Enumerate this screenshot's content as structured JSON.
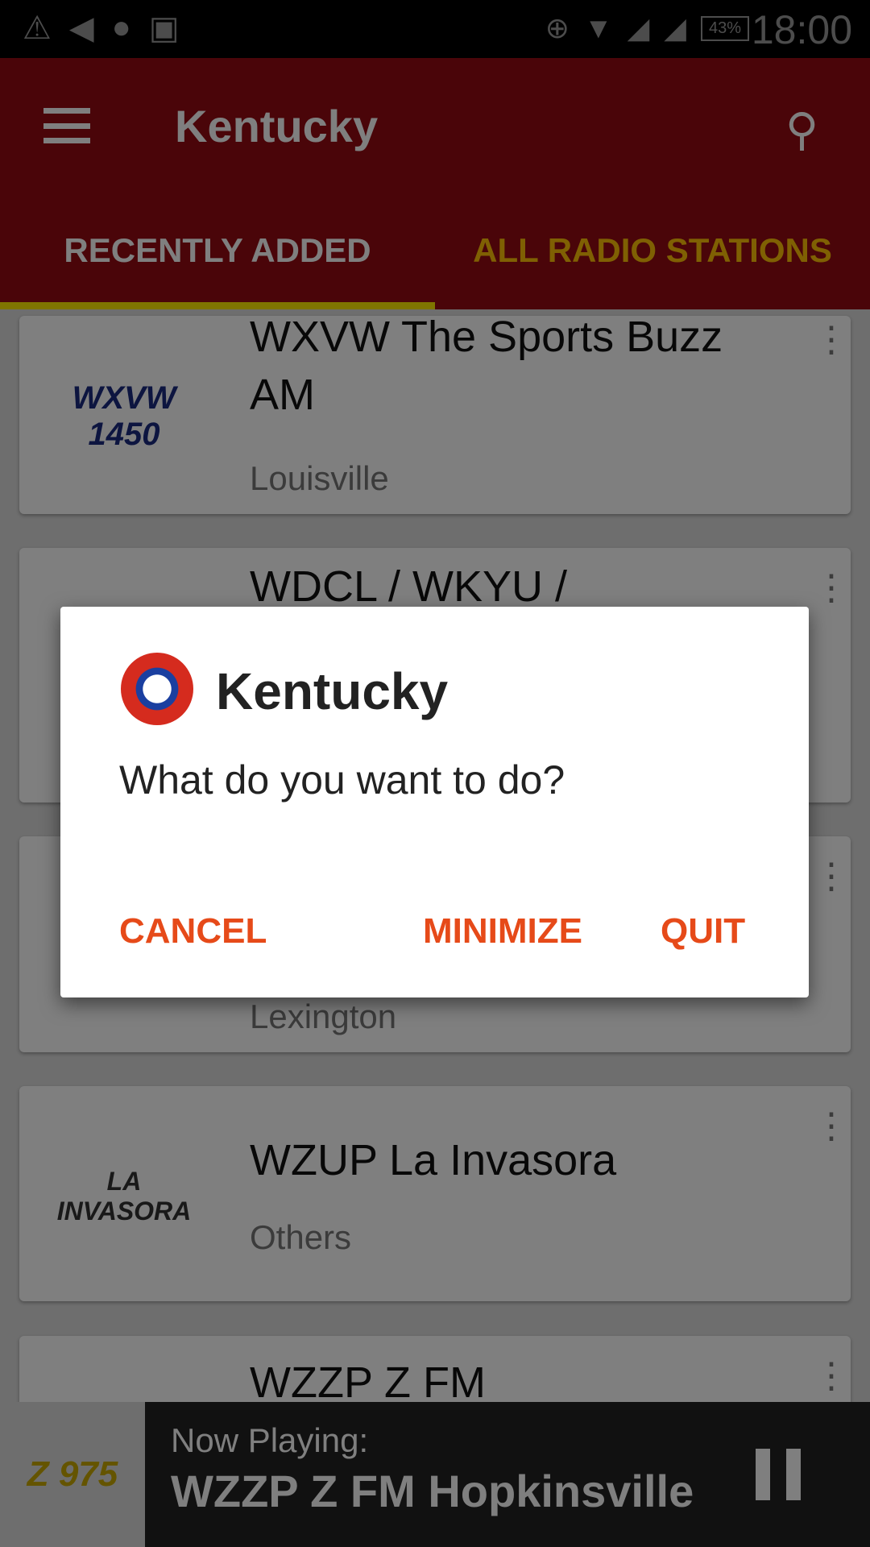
{
  "status_bar": {
    "battery": "43%",
    "time": "18:00"
  },
  "toolbar": {
    "title": "Kentucky"
  },
  "tabs": [
    {
      "label": "RECENTLY ADDED",
      "selected": true
    },
    {
      "label": "ALL RADIO STATIONS",
      "selected": false
    }
  ],
  "stations": [
    {
      "name": "WXVW The Sports Buzz AM",
      "city": "Louisville",
      "logo": "WXVW 1450"
    },
    {
      "name": "WDCL / WKYU /",
      "city": "",
      "logo": ""
    },
    {
      "name": "",
      "city": "Lexington",
      "logo": ""
    },
    {
      "name": "WZUP La Invasora",
      "city": "Others",
      "logo": "LA INVASORA"
    },
    {
      "name": "WZZP Z FM",
      "city": "",
      "logo": ""
    }
  ],
  "player": {
    "label": "Now Playing:",
    "station": "WZZP Z FM Hopkinsville",
    "logo": "Z 975"
  },
  "dialog": {
    "title": "Kentucky",
    "message": "What do you want to do?",
    "cancel": "CANCEL",
    "minimize": "MINIMIZE",
    "quit": "QUIT"
  },
  "colors": {
    "toolbar": "#940a12",
    "tab_indicator": "#ffeb00",
    "dialog_button": "#e64a19"
  }
}
